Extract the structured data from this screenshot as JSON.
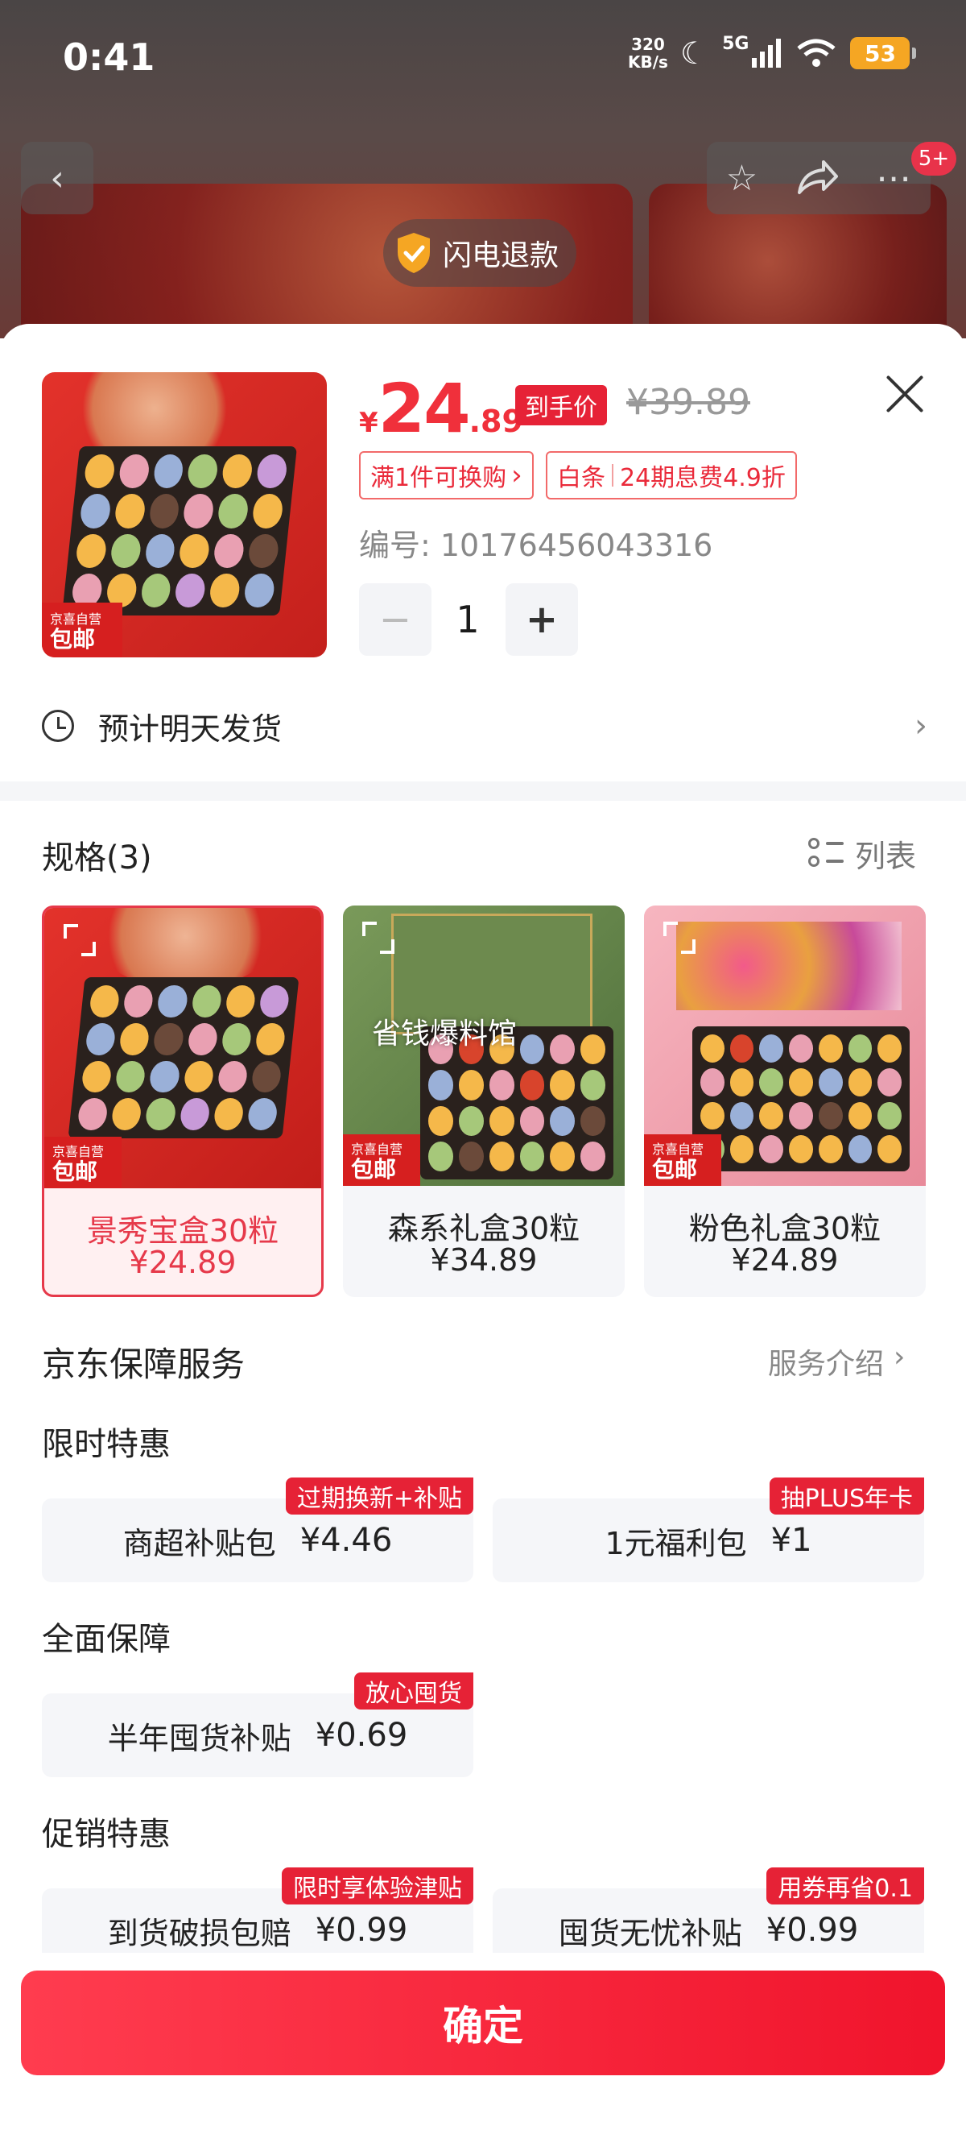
{
  "status_bar": {
    "time": "0:41",
    "speed_value": "320",
    "speed_unit": "KB/s",
    "network": "5G",
    "battery": "53"
  },
  "background": {
    "refund_label": "闪电退款",
    "badge_count": "5+"
  },
  "product": {
    "price_symbol": "¥",
    "price_int": "24",
    "price_dec": ".89",
    "final_price_tag": "到手价",
    "original_price": "¥39.89",
    "ship_tag_line1": "京喜自营",
    "ship_tag_line2": "包邮",
    "promo_exchange": "满1件可换购",
    "promo_exchange_arrow": "›",
    "promo_baitiao_label": "白条",
    "promo_baitiao_value": "24期息费4.9折",
    "sku_number": "编号: 10176456043316",
    "quantity": "1",
    "minus": "−",
    "plus": "+"
  },
  "shipping": {
    "text": "预计明天发货",
    "chevron": "›"
  },
  "specs": {
    "title": "规格(3)",
    "view_toggle": "列表",
    "items": [
      {
        "name": "景秀宝盒30粒",
        "price": "¥24.89",
        "tag1": "京喜自营",
        "tag2": "包邮",
        "overlay": ""
      },
      {
        "name": "森系礼盒30粒",
        "price": "¥34.89",
        "tag1": "京喜自营",
        "tag2": "包邮",
        "overlay": "省钱爆料馆"
      },
      {
        "name": "粉色礼盒30粒",
        "price": "¥24.89",
        "tag1": "京喜自营",
        "tag2": "包邮",
        "overlay": ""
      }
    ]
  },
  "guarantee": {
    "title": "京东保障服务",
    "intro_link": "服务介绍",
    "intro_chevron": "›",
    "sections": [
      {
        "title": "限时特惠",
        "items": [
          {
            "name": "商超补贴包",
            "price": "¥4.46",
            "tag": "过期换新+补贴"
          },
          {
            "name": "1元福利包",
            "price": "¥1",
            "tag": "抽PLUS年卡"
          }
        ]
      },
      {
        "title": "全面保障",
        "items": [
          {
            "name": "半年囤货补贴",
            "price": "¥0.69",
            "tag": "放心囤货"
          }
        ]
      },
      {
        "title": "促销特惠",
        "items": [
          {
            "name": "到货破损包赔",
            "price": "¥0.99",
            "tag": "限时享体验津贴"
          },
          {
            "name": "囤货无忧补贴",
            "price": "¥0.99",
            "tag": "用券再省0.1"
          }
        ]
      }
    ]
  },
  "confirm_label": "确定",
  "colors": {
    "accent": "#f0303b",
    "tag_red": "#e62236",
    "muted": "#888888",
    "card_bg": "#f5f6f9"
  }
}
